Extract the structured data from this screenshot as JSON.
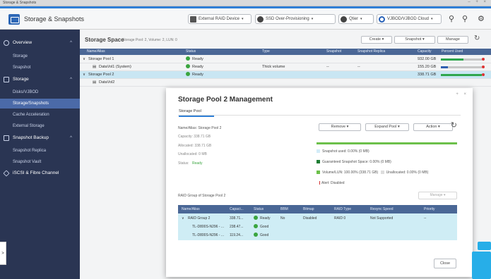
{
  "window": {
    "title": "Storage & Snapshots",
    "controls": "– + ×"
  },
  "toolbar": {
    "app_title": "Storage & Snapshots",
    "external_raid": "External RAID Device",
    "ssd_overprov": "SSD Over-Provisioning",
    "qtier": "Qtier",
    "vjbod": "VJBOD/VJBOD Cloud",
    "icons": {
      "search": "search-icon",
      "settings": "gear-icon"
    }
  },
  "sidebar": {
    "items": [
      {
        "label": "Overview",
        "icon": "overview-icon"
      },
      {
        "label": "Storage"
      },
      {
        "label": "Snapshot"
      },
      {
        "label": "Storage",
        "icon": "storage-icon"
      },
      {
        "label": "Disks/VJBOD"
      },
      {
        "label": "Storage/Snapshots"
      },
      {
        "label": "Cache Acceleration"
      },
      {
        "label": "External Storage"
      },
      {
        "label": "Snapshot Backup",
        "icon": "backup-icon"
      },
      {
        "label": "Snapshot Replica"
      },
      {
        "label": "Snapshot Vault"
      },
      {
        "label": "iSCSI & Fibre Channel",
        "icon": "iscsi-icon"
      }
    ],
    "chevron": "^"
  },
  "storage_space": {
    "title": "Storage Space",
    "subtitle": "Storage Pool: 2, Volume: 2, LUN: 0",
    "buttons": {
      "create": "Create",
      "snapshot": "Snapshot",
      "manage": "Manage"
    },
    "columns": [
      "Name/Alias",
      "Status",
      "Type",
      "Snapshot",
      "Snapshot Replica",
      "Capacity",
      "Percent Used"
    ],
    "rows": [
      {
        "expander": "∨",
        "name": "Storage Pool 1",
        "status": "Ready",
        "type": "",
        "snapshot": "",
        "replica": "",
        "capacity": "932.00 GB",
        "used": 0.55,
        "bar_color": "#2fa64d"
      },
      {
        "name": "DataVol1 (System)",
        "status": "Ready",
        "type": "Thick volume",
        "snapshot": "--",
        "replica": "--",
        "capacity": "155.20 GB",
        "used": 0.18,
        "bar_color": "#2f5fb0"
      },
      {
        "expander": "∨",
        "name": "Storage Pool 2",
        "status": "Ready",
        "type": "",
        "snapshot": "",
        "replica": "",
        "capacity": "338.71 GB",
        "used": 1.0,
        "bar_color": "#2fa64d"
      },
      {
        "name": "DataVol2",
        "status": "",
        "type": "",
        "snapshot": "",
        "replica": "",
        "capacity": "",
        "used": 0,
        "bar_color": "#c7c7c7"
      }
    ]
  },
  "modal": {
    "title": "Storage Pool 2 Management",
    "tab": "Storage Pool",
    "info": {
      "name": "Name/Alias: Storage Pool 2",
      "capacity": "Capacity:  338.71 GB",
      "allocated": "Allocated:  338.71 GB",
      "unallocated": "Unallocated:  0 MB",
      "status_label": "Status:",
      "status": "Ready"
    },
    "buttons": {
      "remove": "Remove",
      "expand": "Expand Pool",
      "action": "Action"
    },
    "legend": {
      "snapshot_used": "Snapshot used: 0.00% (0 MB)",
      "guaranteed": "Guaranteed Snapshot Space: 0.00% (0 MB)",
      "volume_lun": "Volume/LUN: 100.00% (338.71 GB)",
      "unallocated": "Unallocated: 0.00% (0 MB)",
      "alert": "Alert: Disabled"
    },
    "legend_colors": {
      "snapshot": "#d3ecf8",
      "guaranteed": "#1e7d34",
      "volume": "#6cc04a",
      "unalloc": "#dddddd",
      "alert": "#d33333"
    },
    "raid_label": "RAID Group of Storage Pool 2",
    "manage": "Manage",
    "raid_columns": [
      "Name/Alias",
      "Capaci...",
      "Status",
      "BBM",
      "Bitmap",
      "RAID Type",
      "Resync Speed",
      "Priority"
    ],
    "raid_rows": [
      {
        "expander": "∨",
        "name": "RAID Group 2",
        "capacity": "338.71...",
        "status": "Ready",
        "bbm": "No",
        "bitmap": "Disabled",
        "raid_type": "RAID 0",
        "resync": "Not Supported",
        "priority": "--"
      },
      {
        "name": "TL-D800S-N296 - ...",
        "capacity": "238.47...",
        "status": "Good"
      },
      {
        "name": "TL-D800S-N296 - ...",
        "capacity": "119.24...",
        "status": "Good"
      }
    ],
    "close": "Close",
    "window_controls": "+ ×"
  },
  "side_tab": {
    "label": ">"
  }
}
